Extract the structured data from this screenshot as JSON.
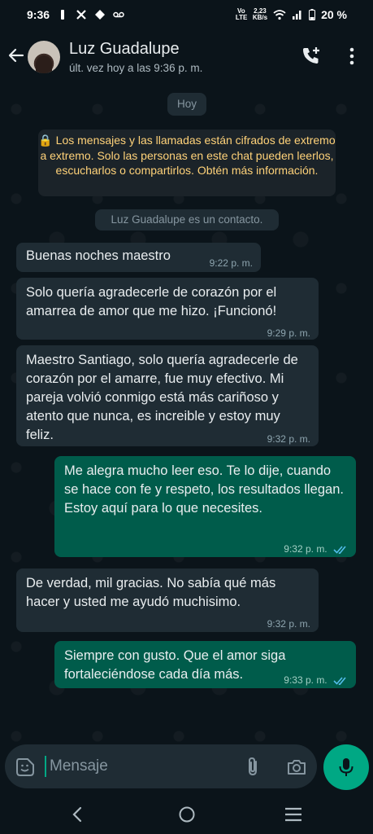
{
  "status_bar": {
    "time": "9:36",
    "net_speed": "2,23",
    "net_unit": "KB/s",
    "network_label": "Vo LTE",
    "battery": "20 %"
  },
  "header": {
    "contact_name": "Luz Guadalupe",
    "last_seen": "últ. vez hoy a las 9:36 p. m."
  },
  "chat": {
    "day_label": "Hoy",
    "encryption_notice": "🔒 Los mensajes y las llamadas están cifrados de extremo a extremo. Solo las personas en este chat pueden leerlos, escucharlos o compartirlos. Obtén más información.",
    "contact_notice": "Luz Guadalupe es un contacto.",
    "messages": [
      {
        "direction": "in",
        "text": "Buenas noches maestro",
        "time": "9:22 p. m."
      },
      {
        "direction": "in",
        "text": "Solo quería agradecerle de corazón por el amarrea de amor que me hizo. ¡Funcionó!",
        "time": "9:29 p. m."
      },
      {
        "direction": "in",
        "text": "Maestro Santiago, solo quería agradecerle de corazón por el amarre, fue muy efectivo. Mi pareja volvió conmigo está más cariñoso y atento que nunca, es increible y estoy muy feliz.",
        "time": "9:32 p. m."
      },
      {
        "direction": "out",
        "text": "Me alegra mucho leer eso. Te lo dije, cuando se hace con fe y respeto, los resultados llegan.\nEstoy aquí para lo que necesites.",
        "time": "9:32 p. m.",
        "status": "read"
      },
      {
        "direction": "in",
        "text": "De verdad, mil gracias. No sabía qué más hacer y usted me ayudó muchisimo.",
        "time": "9:32 p. m."
      },
      {
        "direction": "out",
        "text": "Siempre con gusto. Que el amor siga fortaleciéndose cada día más.",
        "time": "9:33 p. m.",
        "status": "read"
      }
    ]
  },
  "composer": {
    "placeholder": "Mensaje"
  },
  "icons": {
    "back": "arrow-left-icon",
    "call_add": "add-call-icon",
    "menu": "more-vertical-icon",
    "emoji": "sticker-icon",
    "attach": "paperclip-icon",
    "camera": "camera-icon",
    "mic": "microphone-icon"
  },
  "colors": {
    "background": "#0b141a",
    "incoming_bubble": "#1f2c34",
    "outgoing_bubble": "#005c4b",
    "accent": "#00a884",
    "read_check": "#53bdeb",
    "encryption_text": "#ffd279"
  }
}
